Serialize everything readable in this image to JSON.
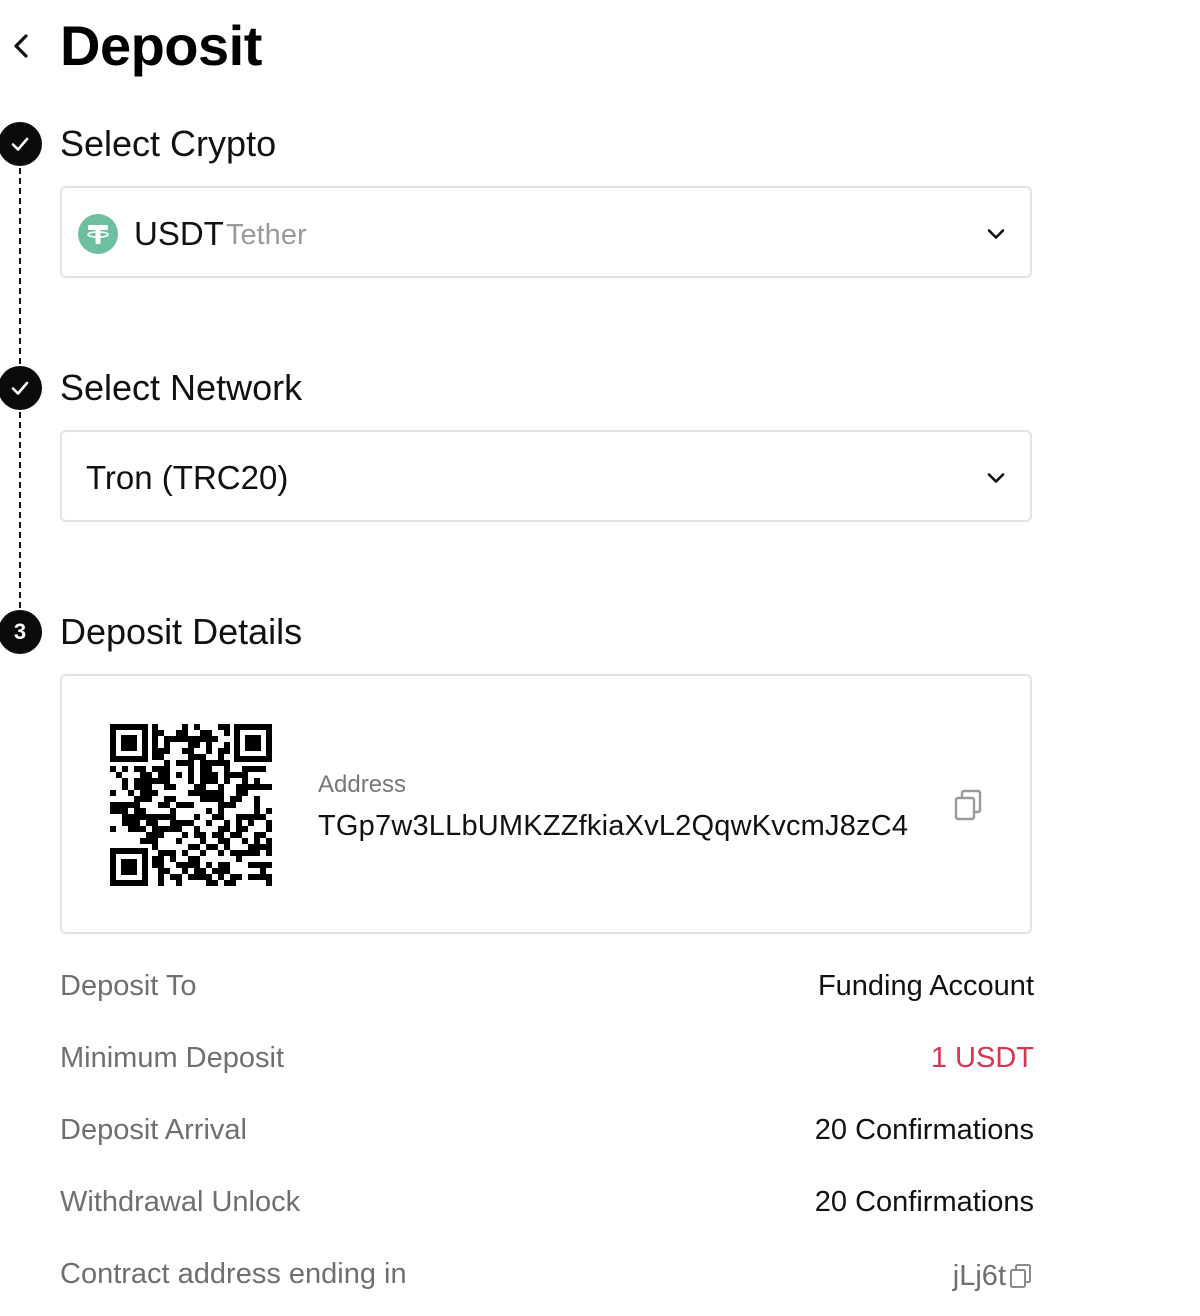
{
  "header": {
    "title": "Deposit"
  },
  "steps": {
    "crypto": {
      "title": "Select Crypto",
      "selected_code": "USDT",
      "selected_name": "Tether",
      "icon": "tether-icon"
    },
    "network": {
      "title": "Select Network",
      "selected": "Tron (TRC20)"
    },
    "details": {
      "number": "3",
      "title": "Deposit Details",
      "address_label": "Address",
      "address": "TGp7w3LLbUMKZZfkiaXvL2QqwKvcmJ8zC4"
    }
  },
  "info": [
    {
      "label": "Deposit To",
      "value": "Funding Account"
    },
    {
      "label": "Minimum Deposit",
      "value": "1 USDT"
    },
    {
      "label": "Deposit Arrival",
      "value": "20 Confirmations"
    },
    {
      "label": "Withdrawal Unlock",
      "value": "20 Confirmations"
    },
    {
      "label": "Contract address ending in",
      "value": "jLj6t"
    }
  ],
  "colors": {
    "accent": "#d6354d",
    "tether": "#6dbf9f",
    "step": "#0b0b0b",
    "border": "#e3e3e3"
  }
}
